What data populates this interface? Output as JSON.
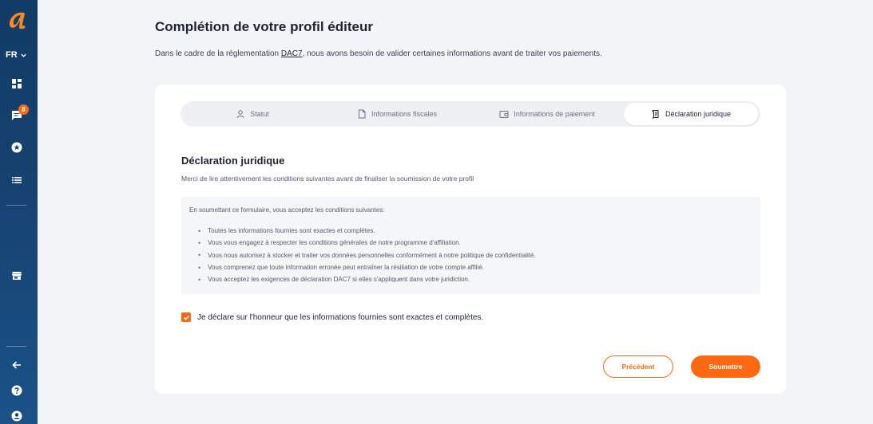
{
  "sidebar": {
    "language": "FR",
    "chat_badge": "8"
  },
  "header": {
    "title": "Complétion de votre profil éditeur",
    "subtitle_prefix": "Dans le cadre de la réglementation ",
    "subtitle_link": "DAC7",
    "subtitle_suffix": ", nous avons besoin de valider certaines informations avant de traiter vos paiements."
  },
  "stepper": {
    "steps": [
      {
        "label": "Statut",
        "icon": "user-icon",
        "active": false
      },
      {
        "label": "Informations fiscales",
        "icon": "document-icon",
        "active": false
      },
      {
        "label": "Informations de paiement",
        "icon": "wallet-icon",
        "active": false
      },
      {
        "label": "Déclaration juridique",
        "icon": "scroll-icon",
        "active": true
      }
    ]
  },
  "section": {
    "title": "Déclaration juridique",
    "subtitle": "Merci de lire attentivement les conditions suivantes avant de finaliser la soumission de votre profil"
  },
  "terms": {
    "intro": "En soumettant ce formulaire, vous acceptez les conditions suivantes:",
    "items": [
      "Toutes les informations fournies sont exactes et complètes.",
      "Vous vous engagez à respecter les conditions générales de notre programme d'affiliation.",
      "Vous nous autorisez à stocker et traiter vos données personnelles conformément à notre politique de confidentialité.",
      "Vous comprenez que toute information erronée peut entraîner la résiliation de votre compte affilié.",
      "Vous acceptez les exigences de déclaration DAC7 si elles s'appliquent dans votre juridiction."
    ]
  },
  "declaration": {
    "checked": true,
    "label": "Je déclare sur l'honneur que les informations fournies sont exactes et complètes."
  },
  "actions": {
    "previous_label": "Précédent",
    "submit_label": "Soumettre"
  },
  "colors": {
    "accent": "#ff6a13",
    "sidebar": "#16416f"
  }
}
